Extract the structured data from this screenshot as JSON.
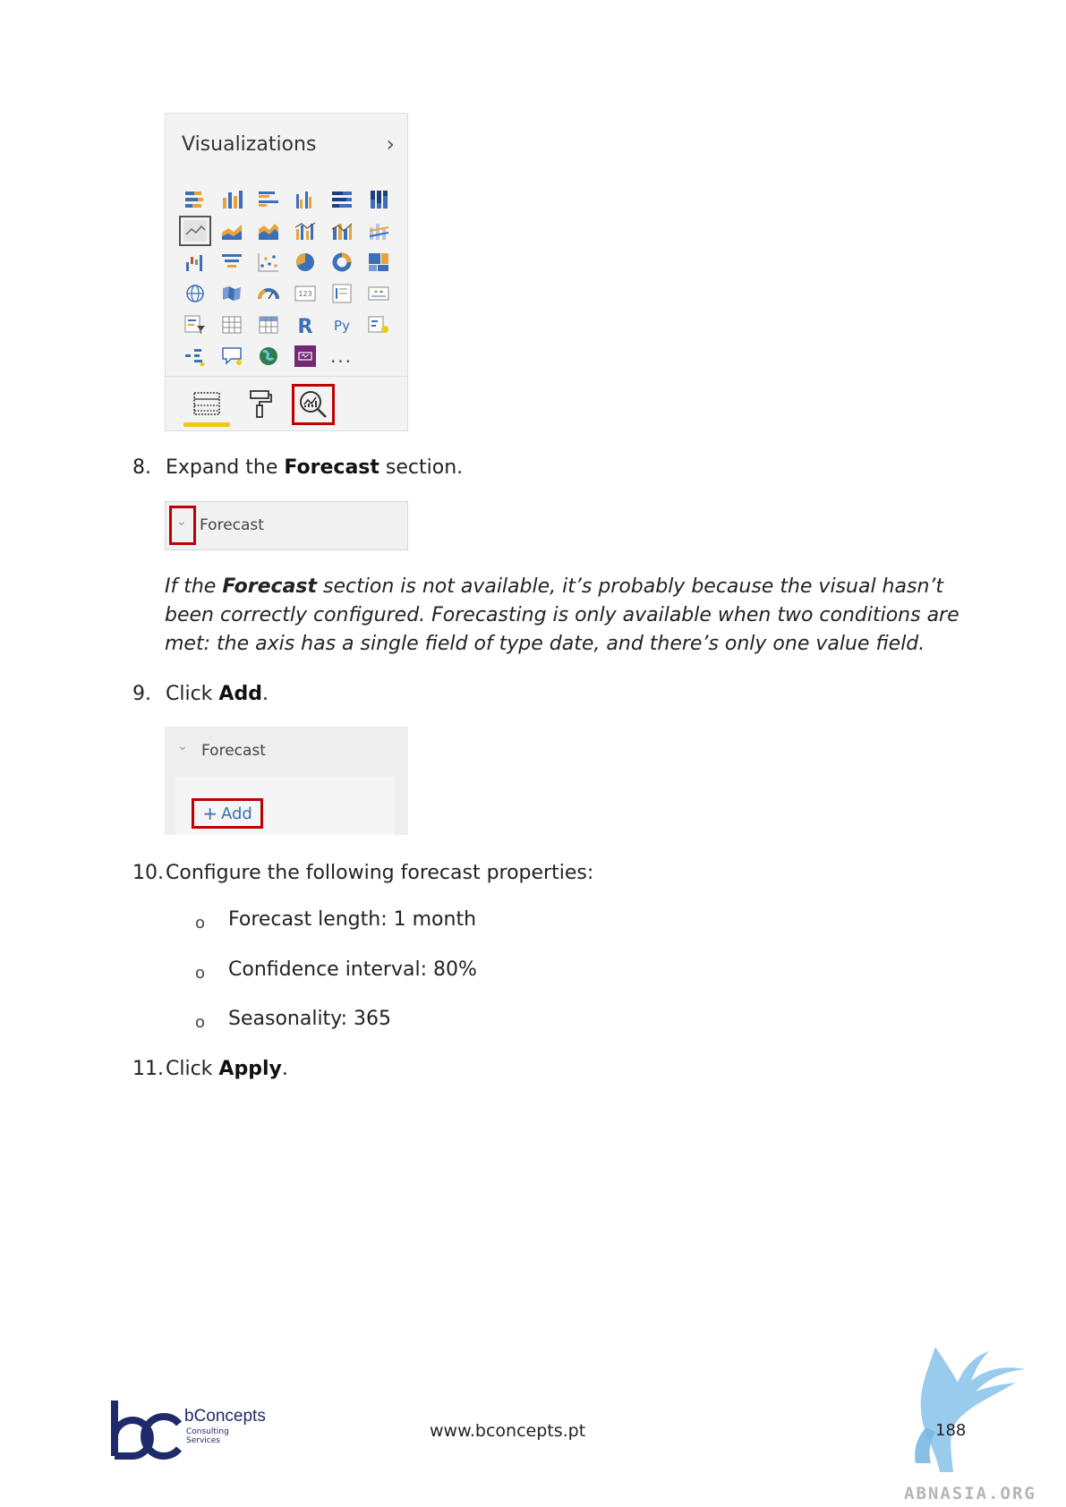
{
  "viz_panel": {
    "title": "Visualizations",
    "more_glyph": "...",
    "icons": [
      "stacked-bar-chart-icon",
      "stacked-column-chart-icon",
      "clustered-bar-chart-icon",
      "clustered-column-chart-icon",
      "100-stacked-bar-chart-icon",
      "100-stacked-column-chart-icon",
      "line-chart-icon",
      "area-chart-icon",
      "stacked-area-chart-icon",
      "line-clustered-column-chart-icon",
      "line-stacked-column-chart-icon",
      "ribbon-chart-icon",
      "waterfall-chart-icon",
      "funnel-chart-icon",
      "scatter-chart-icon",
      "pie-chart-icon",
      "donut-chart-icon",
      "treemap-icon",
      "map-icon",
      "filled-map-icon",
      "gauge-icon",
      "card-icon",
      "multi-row-card-icon",
      "kpi-icon",
      "slicer-icon",
      "table-icon",
      "matrix-icon",
      "r-script-visual-icon",
      "python-visual-icon",
      "key-influencers-icon",
      "decomposition-tree-icon",
      "qa-visual-icon",
      "arcgis-map-icon",
      "power-apps-icon",
      "more-visuals-icon"
    ],
    "tabs": [
      "fields-tab-icon",
      "format-tab-icon",
      "analytics-tab-icon"
    ]
  },
  "steps": {
    "s8": {
      "num": "8.",
      "pre": "Expand the ",
      "bold": "Forecast",
      "post": " section."
    },
    "s9": {
      "num": "9.",
      "pre": "Click ",
      "bold": "Add",
      "post": "."
    },
    "s10": {
      "num": "10.",
      "text": "Configure the following forecast properties:"
    },
    "s11": {
      "num": "11.",
      "pre": "Click ",
      "bold": "Apply",
      "post": "."
    }
  },
  "forecast1": {
    "label": "Forecast"
  },
  "note": {
    "pre": "If the ",
    "bold": "Forecast",
    "post": " section is not available, it’s probably because the visual hasn’t been correctly configured. Forecasting is only available when two conditions are met: the axis has a single field of type date, and there’s only one value field."
  },
  "forecast2": {
    "label": "Forecast",
    "add_label": "Add"
  },
  "bullets": {
    "marker": "o",
    "items": [
      "Forecast length: 1 month",
      "Confidence interval: 80%",
      "Seasonality: 365"
    ]
  },
  "footer": {
    "brand_name": "bConcepts",
    "brand_sub1": "Consulting",
    "brand_sub2": "Services",
    "url": "www.bconcepts.pt",
    "page": "188",
    "watermark": "ABNASIA.ORG"
  },
  "colors": {
    "highlight": "#c00000",
    "accent_yellow": "#f2c811",
    "brand_navy": "#1f2a6b",
    "link_blue": "#3a6fb5"
  }
}
